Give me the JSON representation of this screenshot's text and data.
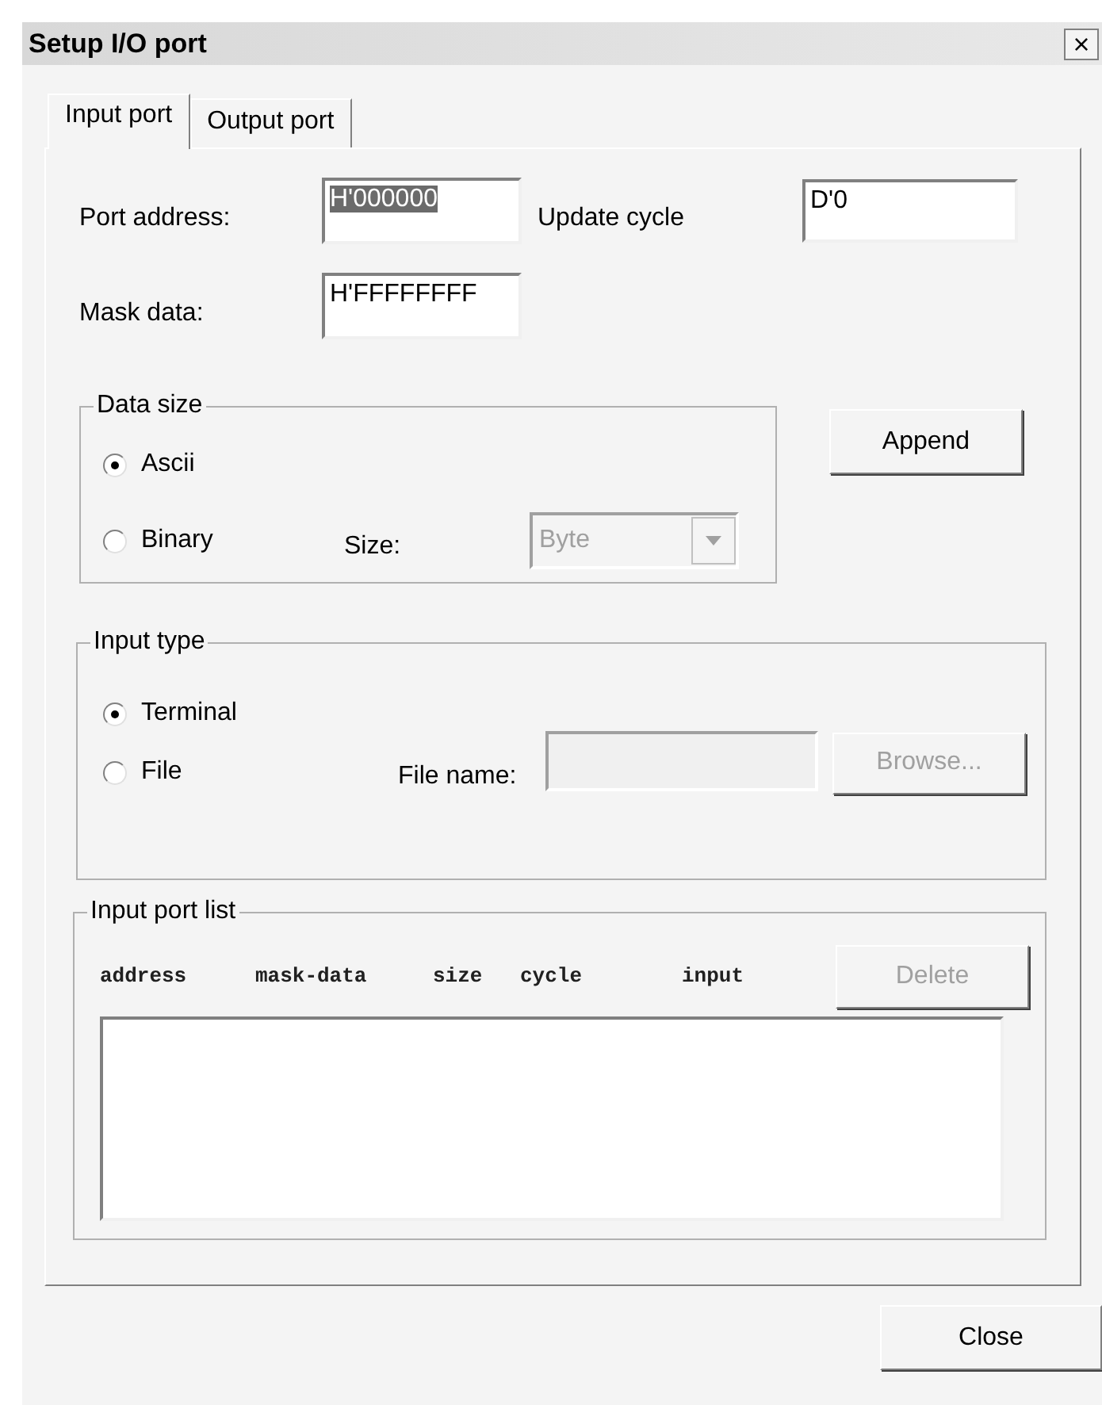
{
  "window": {
    "title": "Setup I/O port",
    "close": "×"
  },
  "tabs": [
    {
      "label": "Input port",
      "selected": true
    },
    {
      "label": "Output port",
      "selected": false
    }
  ],
  "fields": {
    "port_address": {
      "label": "Port address:",
      "value": "H'000000",
      "selected_text": true
    },
    "update_cycle": {
      "label": "Update cycle",
      "value": "D'0"
    },
    "mask_data": {
      "label": "Mask data:",
      "value": "H'FFFFFFFF"
    }
  },
  "data_size": {
    "title": "Data size",
    "options": [
      {
        "label": "Ascii",
        "selected": true
      },
      {
        "label": "Binary",
        "selected": false
      }
    ],
    "size_label": "Size:",
    "size_value": "Byte",
    "size_disabled": true
  },
  "append_button": "Append",
  "input_type": {
    "title": "Input type",
    "options": [
      {
        "label": "Terminal",
        "selected": true
      },
      {
        "label": "File",
        "selected": false
      }
    ],
    "file_name_label": "File name:",
    "file_name_disabled": true,
    "browse": {
      "label": "Browse...",
      "disabled": true
    }
  },
  "input_port_list": {
    "title": "Input port list",
    "columns": [
      "address",
      "mask-data",
      "size",
      "cycle",
      "input"
    ],
    "delete": {
      "label": "Delete",
      "disabled": true
    }
  },
  "close_button": "Close"
}
